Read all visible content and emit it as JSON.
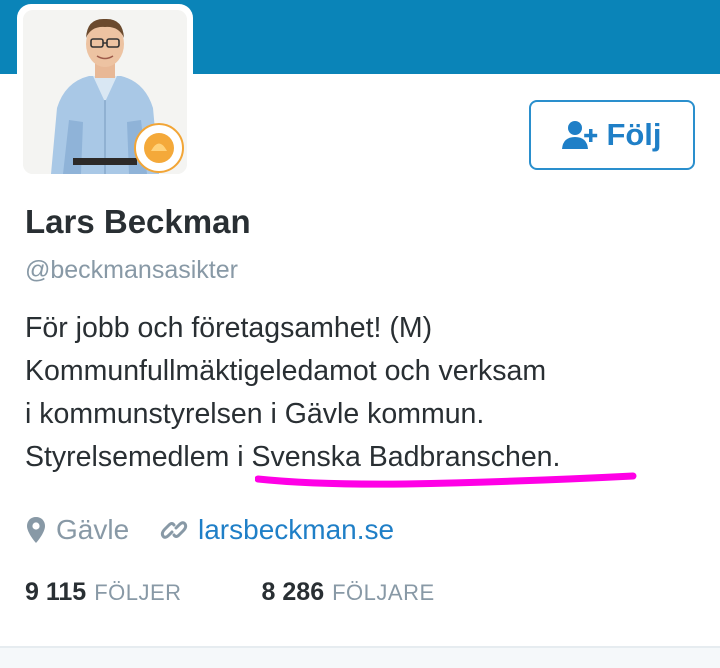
{
  "profile": {
    "name": "Lars Beckman",
    "handle": "@beckmansasikter",
    "follow_label": "Följ",
    "avatar_badge": "företagsamhet",
    "bio_lines": [
      "För jobb och företagsamhet! (M)",
      "Kommunfullmäktigeledamot och verksam",
      "i kommunstyrelsen i Gävle kommun.",
      "Styrelsemedlem i "
    ],
    "bio_link": "Svenska Badbranschen",
    "bio_tail": ".",
    "location": "Gävle",
    "website": "larsbeckman.se"
  },
  "stats": {
    "following_count": "9 115",
    "following_label": "FÖLJER",
    "followers_count": "8 286",
    "followers_label": "FÖLJARE"
  },
  "colors": {
    "banner": "#0a84b8",
    "accent": "#1f7fc7",
    "highlight": "#ff00e6"
  },
  "icons": [
    "add-user-icon",
    "location-pin-icon",
    "link-icon"
  ]
}
